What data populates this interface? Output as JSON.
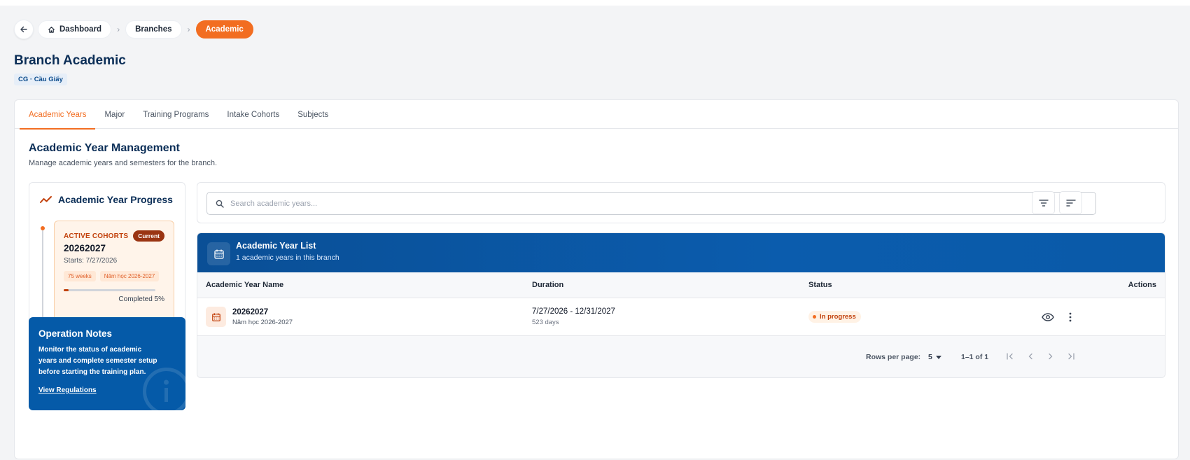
{
  "breadcrumb": {
    "items": [
      {
        "label": "Dashboard"
      },
      {
        "label": "Branches"
      },
      {
        "label": "Academic"
      }
    ]
  },
  "page": {
    "title": "Branch Academic",
    "branch_badge": "CG · Cầu Giấy"
  },
  "tabs": [
    {
      "label": "Academic Years",
      "active": true
    },
    {
      "label": "Major"
    },
    {
      "label": "Training Programs"
    },
    {
      "label": "Intake Cohorts"
    },
    {
      "label": "Subjects"
    }
  ],
  "section": {
    "title": "Academic Year Management",
    "subtitle": "Manage academic years and semesters for the branch."
  },
  "progress": {
    "title": "Academic Year Progress",
    "cohort_label": "ACTIVE COHORTS",
    "current_badge": "Current",
    "code": "20262027",
    "starts": "Starts: 7/27/2026",
    "chips": [
      "75 weeks",
      "Năm học 2026-2027"
    ],
    "completed_fraction": 0.05,
    "completed_text": "Completed 5%"
  },
  "notes": {
    "title": "Operation Notes",
    "text": "Monitor the status of academic years and complete semester setup before starting the training plan.",
    "link": "View Regulations"
  },
  "search": {
    "placeholder": "Search academic years..."
  },
  "list": {
    "title": "Academic Year List",
    "subtitle": "1 academic years in this branch",
    "columns": [
      "Academic Year Name",
      "Duration",
      "Status",
      "Actions"
    ],
    "rows": [
      {
        "name": "20262027",
        "description": "Năm học 2026-2027",
        "duration": "7/27/2026 - 12/31/2027",
        "days": "523 days",
        "status": "In progress"
      }
    ],
    "footer": {
      "rows_per_page_label": "Rows per page:",
      "rows_per_page_value": "5",
      "range": "1–1 of 1"
    }
  },
  "colors": {
    "accent": "#f26d21",
    "primary": "#0b5cad",
    "title": "#0b2e57"
  },
  "icons": {
    "back": "arrow-left-icon",
    "home": "home-icon",
    "progress": "trend-icon",
    "search": "search-icon",
    "filter": "filter-icon",
    "sort": "sort-icon",
    "calendar": "calendar-icon",
    "view": "eye-icon",
    "more": "more-vertical-icon",
    "info": "info-icon"
  }
}
